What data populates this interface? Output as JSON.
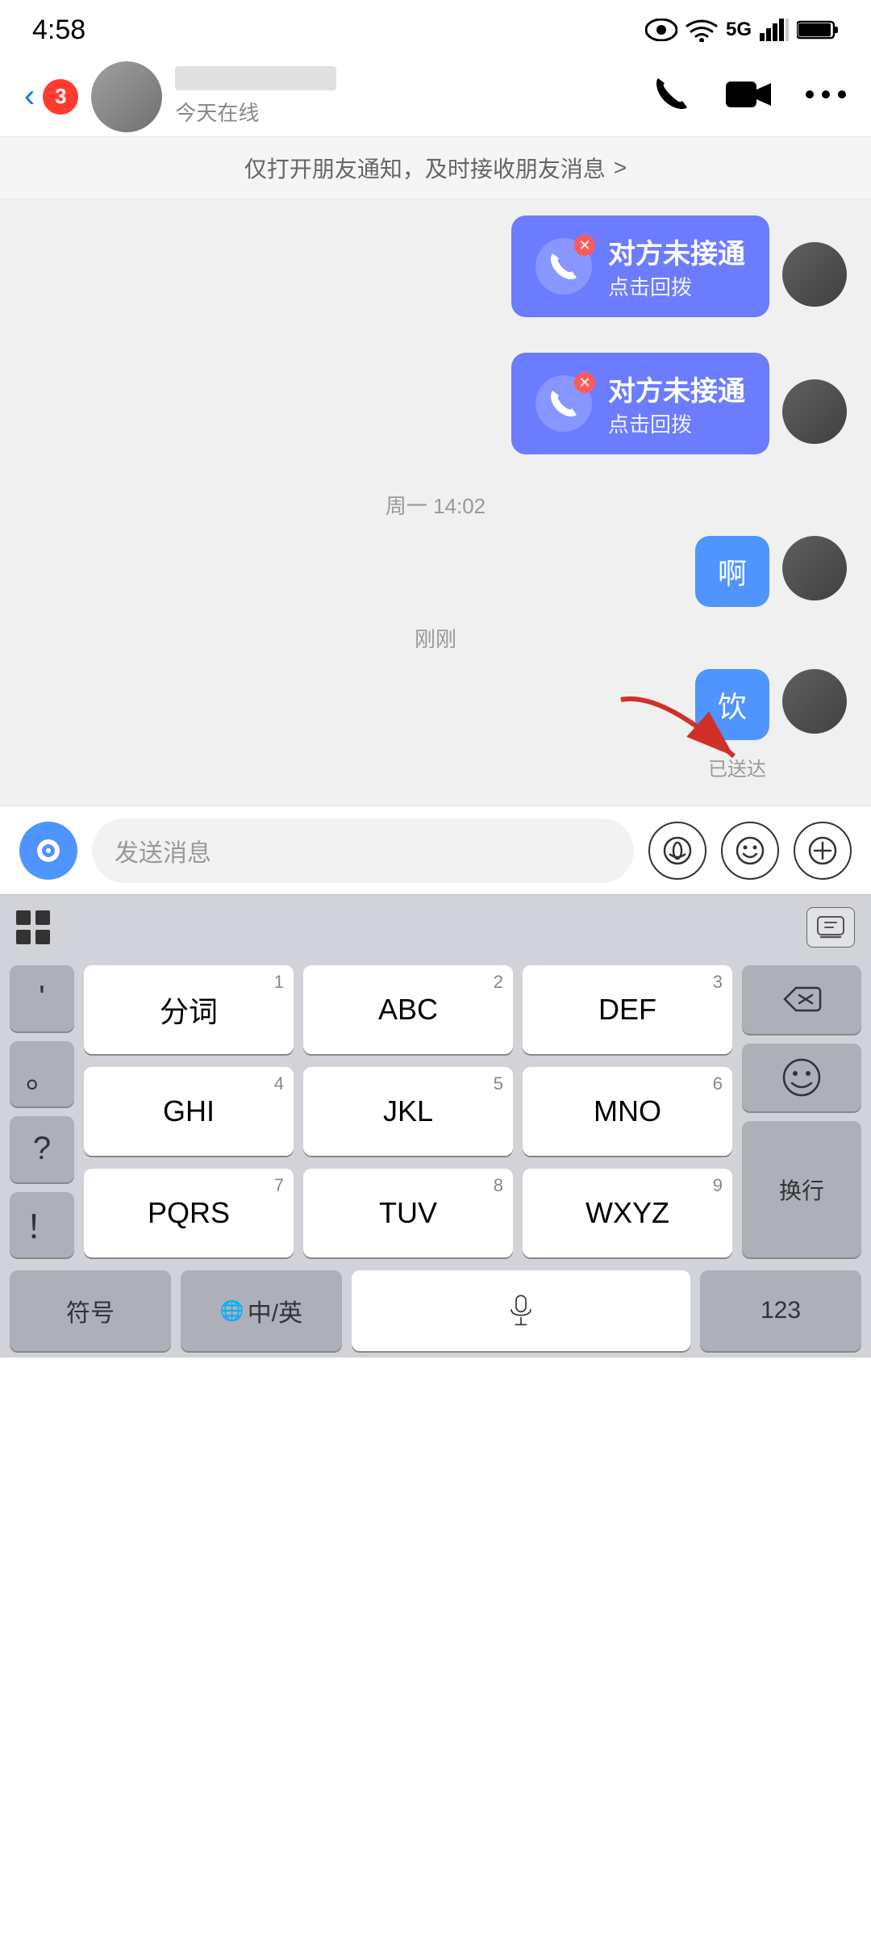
{
  "statusBar": {
    "time": "4:58"
  },
  "navBar": {
    "backCount": "3",
    "contactStatus": "今天在线",
    "phoneLabel": "phone",
    "videoLabel": "video",
    "moreLabel": "more"
  },
  "notificationBanner": {
    "text": "仅打开朋友通知，及时接收朋友消息",
    "arrow": ">"
  },
  "chat": {
    "missedCall1": {
      "title": "对方未接通",
      "subtitle": "点击回拨"
    },
    "missedCall2": {
      "title": "对方未接通",
      "subtitle": "点击回拨"
    },
    "timestamp1": "周一 14:02",
    "bubble1": "啊",
    "timestamp2": "刚刚",
    "bubble2": "饮",
    "delivered": "已送达"
  },
  "inputBar": {
    "placeholder": "发送消息"
  },
  "keyboard": {
    "rows": [
      [
        {
          "main": "分词",
          "number": "1"
        },
        {
          "main": "ABC",
          "number": "2"
        },
        {
          "main": "DEF",
          "number": "3"
        }
      ],
      [
        {
          "main": "GHI",
          "number": "4"
        },
        {
          "main": "JKL",
          "number": "5"
        },
        {
          "main": "MNO",
          "number": "6"
        }
      ],
      [
        {
          "main": "PQRS",
          "number": "7"
        },
        {
          "main": "TUV",
          "number": "8"
        },
        {
          "main": "WXYZ",
          "number": "9"
        }
      ]
    ],
    "punctuation": [
      "'",
      "。",
      "?",
      "！"
    ],
    "bottomRow": {
      "symbol": "符号",
      "chinese": "中/英",
      "num123": "123",
      "newline": "换行"
    }
  }
}
